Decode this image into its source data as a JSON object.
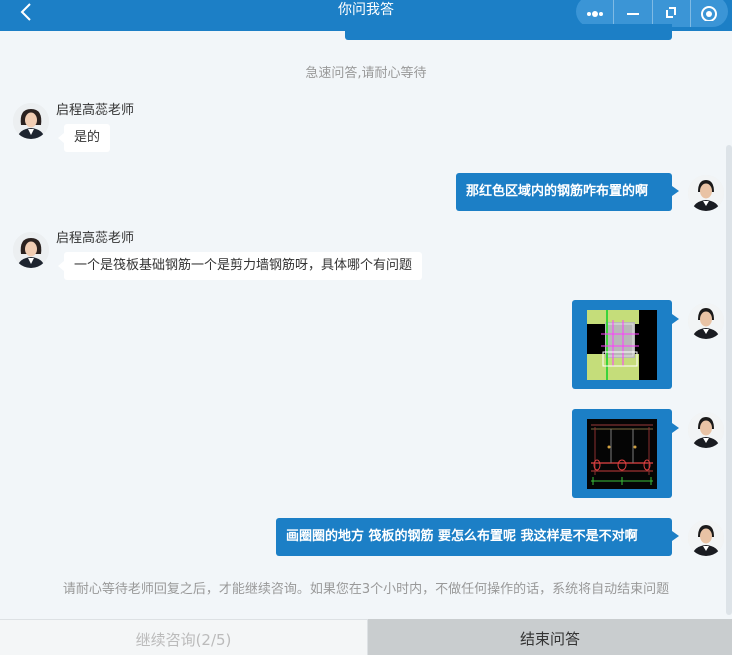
{
  "header": {
    "title": "你问我答",
    "back_icon": "chevron-left-icon",
    "capsule_icons": [
      "more-dots-icon",
      "minimize-icon",
      "restore-icon",
      "target-icon"
    ]
  },
  "system_tip": "急速问答,请耐心等待",
  "messages": [
    {
      "side": "left",
      "sender": "启程高蕊老师",
      "text": "是的"
    },
    {
      "side": "right",
      "text": "那红色区域内的钢筋咋布置的啊"
    },
    {
      "side": "left",
      "sender": "启程高蕊老师",
      "text": "一个是筏板基础钢筋一个是剪力墙钢筋呀，具体哪个有问题"
    },
    {
      "side": "right",
      "type": "image",
      "text": ""
    },
    {
      "side": "right",
      "type": "image",
      "text": ""
    },
    {
      "side": "right",
      "text": "画圈圈的地方 筏板的钢筋 要怎么布置呢 我这样是不是不对啊"
    }
  ],
  "notice": "请耐心等待老师回复之后，才能继续咨询。如果您在3个小时内，不做任何操作的话，系统将自动结束问题",
  "buttons": {
    "continue": "继续咨询(2/5)",
    "end": "结束问答"
  },
  "colors": {
    "brand": "#1c7fc6",
    "background": "#f2f6f9"
  }
}
